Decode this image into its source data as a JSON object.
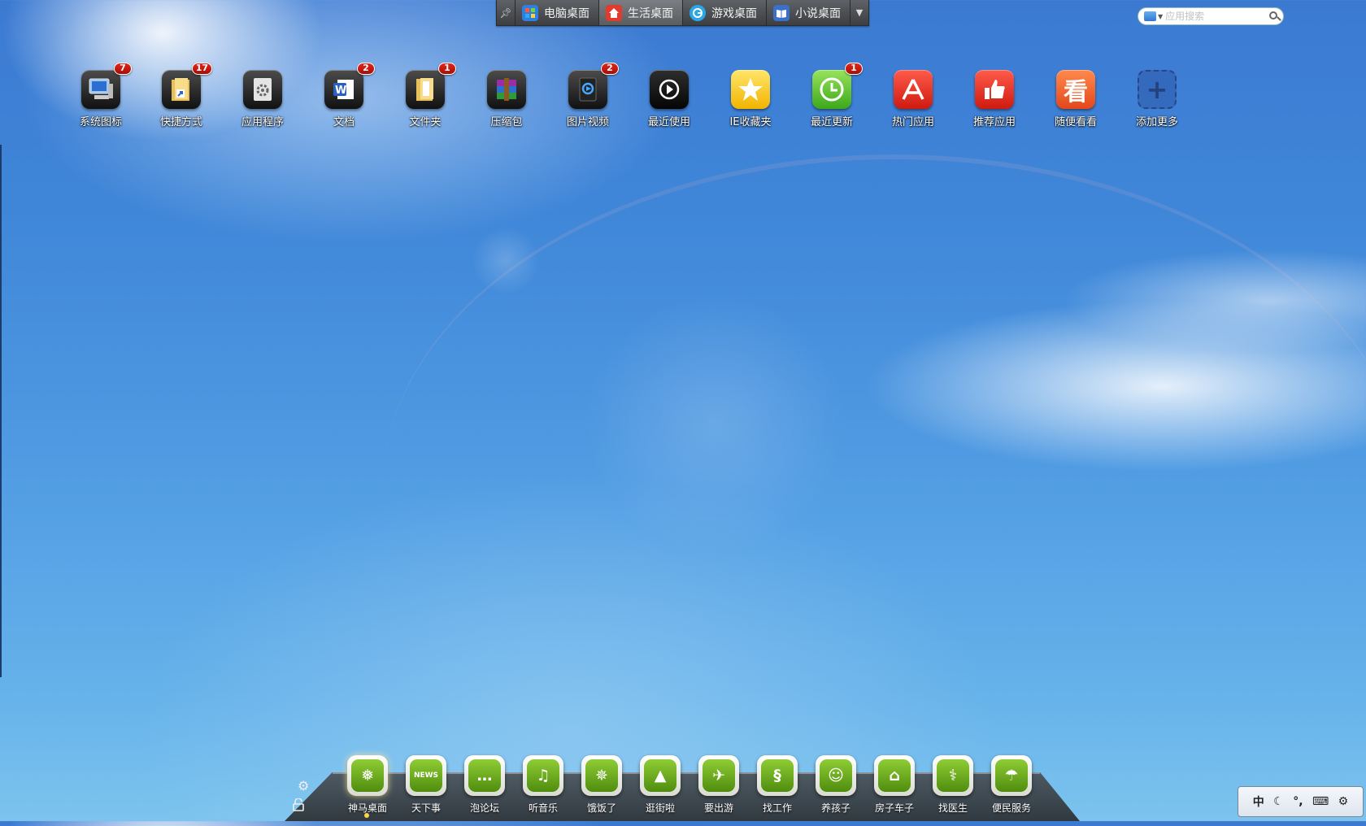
{
  "tabs": [
    {
      "label": "电脑桌面",
      "icon": "windows-icon",
      "color": "#2f7fe0"
    },
    {
      "label": "生活桌面",
      "icon": "home-icon",
      "color": "#e23a2c"
    },
    {
      "label": "游戏桌面",
      "icon": "game-icon",
      "color": "#2aa7e8"
    },
    {
      "label": "小说桌面",
      "icon": "book-icon",
      "color": "#3b6fc8"
    }
  ],
  "active_tab": "生活桌面",
  "search": {
    "placeholder": "应用搜索"
  },
  "desktop_icons": [
    {
      "label": "系统图标",
      "badge": "7",
      "icon": "computer-icon"
    },
    {
      "label": "快捷方式",
      "badge": "17",
      "icon": "shortcut-folder-icon"
    },
    {
      "label": "应用程序",
      "badge": "",
      "icon": "application-icon"
    },
    {
      "label": "文档",
      "badge": "2",
      "icon": "word-document-icon"
    },
    {
      "label": "文件夹",
      "badge": "1",
      "icon": "folder-icon"
    },
    {
      "label": "压缩包",
      "badge": "",
      "icon": "winrar-icon"
    },
    {
      "label": "图片视频",
      "badge": "2",
      "icon": "media-icon"
    },
    {
      "label": "最近使用",
      "badge": "",
      "icon": "recent-icon"
    },
    {
      "label": "IE收藏夹",
      "badge": "",
      "icon": "star-icon"
    },
    {
      "label": "最近更新",
      "badge": "1",
      "icon": "clock-icon"
    },
    {
      "label": "热门应用",
      "badge": "",
      "icon": "app-store-icon"
    },
    {
      "label": "推荐应用",
      "badge": "",
      "icon": "thumbs-up-icon"
    },
    {
      "label": "随便看看",
      "badge": "",
      "icon": "look-icon"
    },
    {
      "label": "添加更多",
      "badge": "",
      "icon": "add-icon"
    }
  ],
  "dock": {
    "items": [
      {
        "label": "神马桌面",
        "icon": "china-map-icon"
      },
      {
        "label": "天下事",
        "icon": "news-icon"
      },
      {
        "label": "泡论坛",
        "icon": "chat-icon"
      },
      {
        "label": "听音乐",
        "icon": "music-icon"
      },
      {
        "label": "饿饭了",
        "icon": "food-icon"
      },
      {
        "label": "逛街啦",
        "icon": "dress-icon"
      },
      {
        "label": "要出游",
        "icon": "airplane-icon"
      },
      {
        "label": "找工作",
        "icon": "tie-icon"
      },
      {
        "label": "养孩子",
        "icon": "baby-icon"
      },
      {
        "label": "房子车子",
        "icon": "house-icon"
      },
      {
        "label": "找医生",
        "icon": "stethoscope-icon"
      },
      {
        "label": "便民服务",
        "icon": "umbrella-icon"
      }
    ],
    "active": "神马桌面"
  },
  "ime": {
    "mode": "中",
    "punct": "°,"
  },
  "colors": {
    "badge": "#c4150c",
    "dock_green": "#5a9a16",
    "sky": "#3f86d8"
  }
}
